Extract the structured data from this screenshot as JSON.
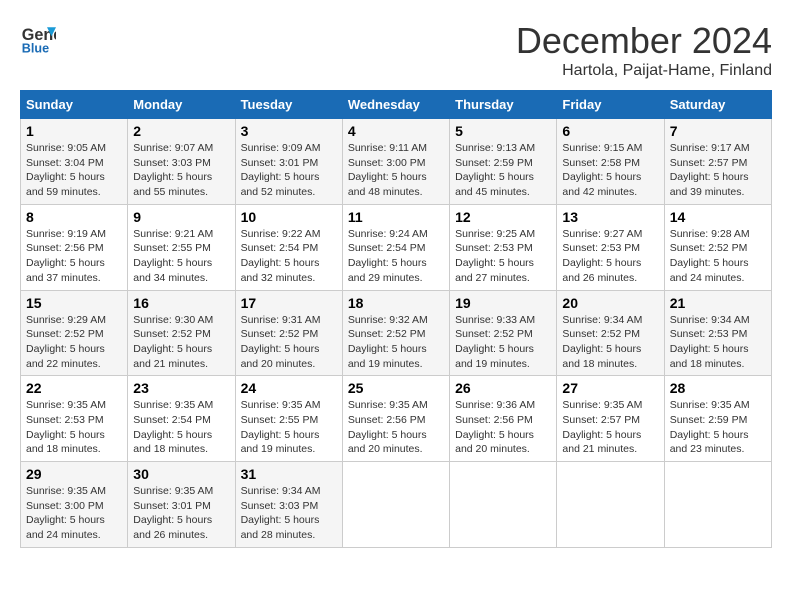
{
  "logo": {
    "line1": "General",
    "line2": "Blue"
  },
  "title": "December 2024",
  "subtitle": "Hartola, Paijat-Hame, Finland",
  "weekdays": [
    "Sunday",
    "Monday",
    "Tuesday",
    "Wednesday",
    "Thursday",
    "Friday",
    "Saturday"
  ],
  "weeks": [
    [
      {
        "day": "1",
        "sunrise": "9:05 AM",
        "sunset": "3:04 PM",
        "daylight": "5 hours and 59 minutes."
      },
      {
        "day": "2",
        "sunrise": "9:07 AM",
        "sunset": "3:03 PM",
        "daylight": "5 hours and 55 minutes."
      },
      {
        "day": "3",
        "sunrise": "9:09 AM",
        "sunset": "3:01 PM",
        "daylight": "5 hours and 52 minutes."
      },
      {
        "day": "4",
        "sunrise": "9:11 AM",
        "sunset": "3:00 PM",
        "daylight": "5 hours and 48 minutes."
      },
      {
        "day": "5",
        "sunrise": "9:13 AM",
        "sunset": "2:59 PM",
        "daylight": "5 hours and 45 minutes."
      },
      {
        "day": "6",
        "sunrise": "9:15 AM",
        "sunset": "2:58 PM",
        "daylight": "5 hours and 42 minutes."
      },
      {
        "day": "7",
        "sunrise": "9:17 AM",
        "sunset": "2:57 PM",
        "daylight": "5 hours and 39 minutes."
      }
    ],
    [
      {
        "day": "8",
        "sunrise": "9:19 AM",
        "sunset": "2:56 PM",
        "daylight": "5 hours and 37 minutes."
      },
      {
        "day": "9",
        "sunrise": "9:21 AM",
        "sunset": "2:55 PM",
        "daylight": "5 hours and 34 minutes."
      },
      {
        "day": "10",
        "sunrise": "9:22 AM",
        "sunset": "2:54 PM",
        "daylight": "5 hours and 32 minutes."
      },
      {
        "day": "11",
        "sunrise": "9:24 AM",
        "sunset": "2:54 PM",
        "daylight": "5 hours and 29 minutes."
      },
      {
        "day": "12",
        "sunrise": "9:25 AM",
        "sunset": "2:53 PM",
        "daylight": "5 hours and 27 minutes."
      },
      {
        "day": "13",
        "sunrise": "9:27 AM",
        "sunset": "2:53 PM",
        "daylight": "5 hours and 26 minutes."
      },
      {
        "day": "14",
        "sunrise": "9:28 AM",
        "sunset": "2:52 PM",
        "daylight": "5 hours and 24 minutes."
      }
    ],
    [
      {
        "day": "15",
        "sunrise": "9:29 AM",
        "sunset": "2:52 PM",
        "daylight": "5 hours and 22 minutes."
      },
      {
        "day": "16",
        "sunrise": "9:30 AM",
        "sunset": "2:52 PM",
        "daylight": "5 hours and 21 minutes."
      },
      {
        "day": "17",
        "sunrise": "9:31 AM",
        "sunset": "2:52 PM",
        "daylight": "5 hours and 20 minutes."
      },
      {
        "day": "18",
        "sunrise": "9:32 AM",
        "sunset": "2:52 PM",
        "daylight": "5 hours and 19 minutes."
      },
      {
        "day": "19",
        "sunrise": "9:33 AM",
        "sunset": "2:52 PM",
        "daylight": "5 hours and 19 minutes."
      },
      {
        "day": "20",
        "sunrise": "9:34 AM",
        "sunset": "2:52 PM",
        "daylight": "5 hours and 18 minutes."
      },
      {
        "day": "21",
        "sunrise": "9:34 AM",
        "sunset": "2:53 PM",
        "daylight": "5 hours and 18 minutes."
      }
    ],
    [
      {
        "day": "22",
        "sunrise": "9:35 AM",
        "sunset": "2:53 PM",
        "daylight": "5 hours and 18 minutes."
      },
      {
        "day": "23",
        "sunrise": "9:35 AM",
        "sunset": "2:54 PM",
        "daylight": "5 hours and 18 minutes."
      },
      {
        "day": "24",
        "sunrise": "9:35 AM",
        "sunset": "2:55 PM",
        "daylight": "5 hours and 19 minutes."
      },
      {
        "day": "25",
        "sunrise": "9:35 AM",
        "sunset": "2:56 PM",
        "daylight": "5 hours and 20 minutes."
      },
      {
        "day": "26",
        "sunrise": "9:36 AM",
        "sunset": "2:56 PM",
        "daylight": "5 hours and 20 minutes."
      },
      {
        "day": "27",
        "sunrise": "9:35 AM",
        "sunset": "2:57 PM",
        "daylight": "5 hours and 21 minutes."
      },
      {
        "day": "28",
        "sunrise": "9:35 AM",
        "sunset": "2:59 PM",
        "daylight": "5 hours and 23 minutes."
      }
    ],
    [
      {
        "day": "29",
        "sunrise": "9:35 AM",
        "sunset": "3:00 PM",
        "daylight": "5 hours and 24 minutes."
      },
      {
        "day": "30",
        "sunrise": "9:35 AM",
        "sunset": "3:01 PM",
        "daylight": "5 hours and 26 minutes."
      },
      {
        "day": "31",
        "sunrise": "9:34 AM",
        "sunset": "3:03 PM",
        "daylight": "5 hours and 28 minutes."
      },
      null,
      null,
      null,
      null
    ]
  ],
  "labels": {
    "sunrise": "Sunrise:",
    "sunset": "Sunset:",
    "daylight": "Daylight:"
  }
}
